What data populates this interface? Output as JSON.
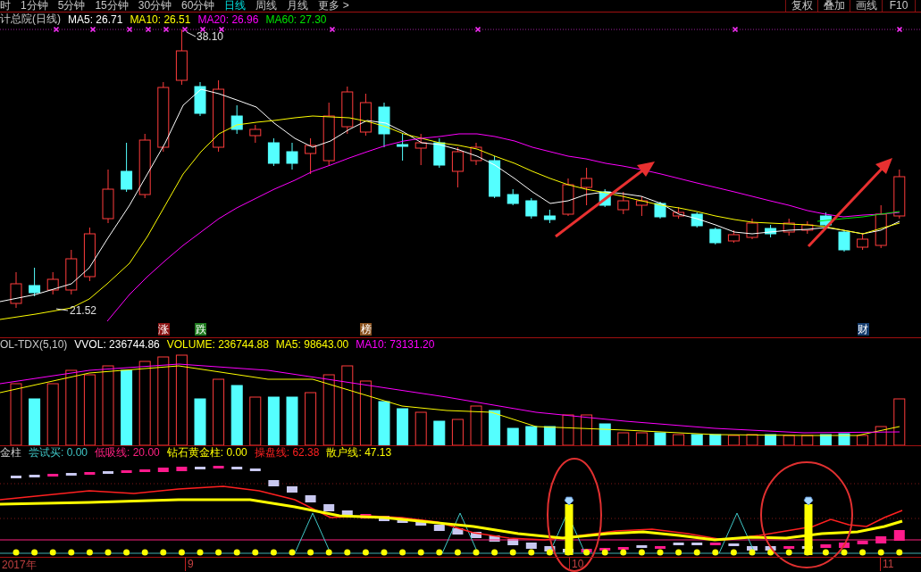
{
  "period_tabs": [
    {
      "label": "时",
      "selected": false
    },
    {
      "label": "1分钟",
      "selected": false
    },
    {
      "label": "5分钟",
      "selected": false
    },
    {
      "label": "15分钟",
      "selected": false
    },
    {
      "label": "30分钟",
      "selected": false
    },
    {
      "label": "60分钟",
      "selected": false
    },
    {
      "label": "日线",
      "selected": true
    },
    {
      "label": "周线",
      "selected": false
    },
    {
      "label": "月线",
      "selected": false
    },
    {
      "label": "更多 >",
      "selected": false
    }
  ],
  "toolbar_buttons": [
    "复权",
    "叠加",
    "画线",
    "F10"
  ],
  "price_panel": {
    "title": "计总院(日线)",
    "indicators": [
      {
        "label": "MA5: 26.71",
        "color": "#ffffff"
      },
      {
        "label": "MA10: 26.51",
        "color": "#ffff00"
      },
      {
        "label": "MA20: 26.96",
        "color": "#ff00ff"
      },
      {
        "label": "MA60: 27.30",
        "color": "#00e600"
      }
    ],
    "high_label": "38.10",
    "low_label": "21.52",
    "event_tags": [
      {
        "label": "涨",
        "color": "#8c1414"
      },
      {
        "label": "跌",
        "color": "#1e7a1e"
      },
      {
        "label": "榜",
        "color": "#8a5320"
      },
      {
        "label": "财",
        "color": "#143c6e"
      }
    ]
  },
  "volume_panel": {
    "title": "OL-TDX(5,10)",
    "indicators": [
      {
        "label": "VVOL: 236744.86",
        "color": "#ffffff"
      },
      {
        "label": "VOLUME: 236744.88",
        "color": "#ffff00"
      },
      {
        "label": "MA5: 98643.00",
        "color": "#ffff00"
      },
      {
        "label": "MA10: 73131.20",
        "color": "#ff00ff"
      }
    ]
  },
  "signal_panel": {
    "title": "金柱",
    "indicators": [
      {
        "label": "尝试买: 0.00",
        "color": "#40c8c8"
      },
      {
        "label": "低吸线: 20.00",
        "color": "#ff2080"
      },
      {
        "label": "钻石黄金柱: 0.00",
        "color": "#ffff00"
      },
      {
        "label": "操盘线: 62.38",
        "color": "#ff2020"
      },
      {
        "label": "散户线: 47.13",
        "color": "#ffff00"
      }
    ]
  },
  "x_axis": {
    "labels": [
      "2017年",
      "9",
      "10",
      "11"
    ]
  }
}
